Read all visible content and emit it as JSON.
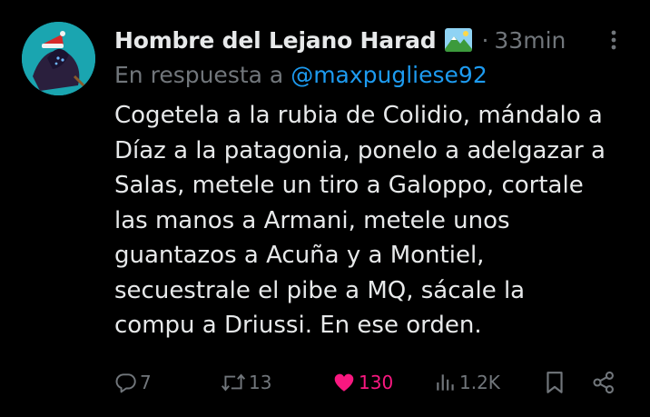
{
  "tweet": {
    "display_name": "Hombre del Lejano Harad",
    "separator": "·",
    "timestamp": "33min",
    "reply_prefix": "En respuesta a",
    "reply_handle": "@maxpugliese92",
    "text": "Cogetela a la rubia de Colidio, mándalo a\nDíaz a la patagonia, ponelo a adelgazar a\nSalas, metele un tiro a Galoppo, cortale\nlas manos a Armani, metele unos\nguantazos a Acuña y a Montiel,\nsecuestrale el pibe a MQ, sácale la\ncompu a Driussi. En ese orden."
  },
  "actions": {
    "replies": "7",
    "reposts": "13",
    "likes": "130",
    "views": "1.2K"
  },
  "icons": {
    "badge": "landscape-emoji-icon",
    "more": "more-vertical-icon",
    "reply": "reply-icon",
    "repost": "repost-icon",
    "like": "heart-filled-icon",
    "views": "views-icon",
    "bookmark": "bookmark-icon",
    "share": "share-icon"
  },
  "colors": {
    "background": "#000000",
    "text": "#e7e9ea",
    "muted": "#71767b",
    "link": "#1d9bf0",
    "like": "#f91880"
  }
}
